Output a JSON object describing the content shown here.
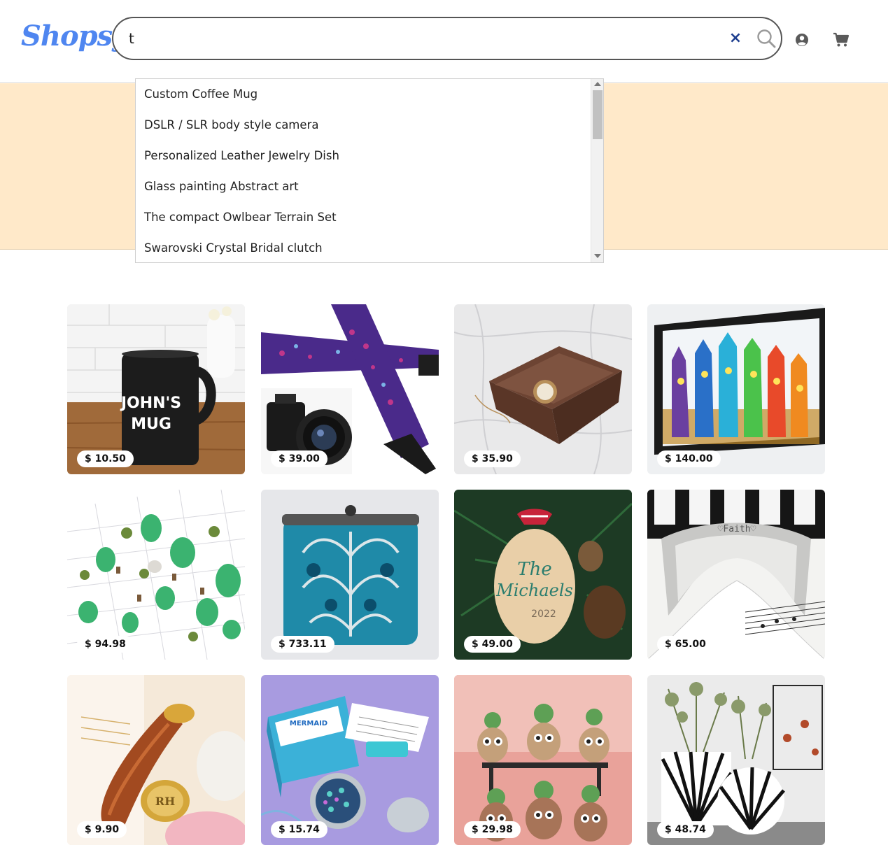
{
  "header": {
    "logo": "Shopsy",
    "search": {
      "value": "t",
      "placeholder": ""
    },
    "clear_symbol": "×",
    "icons": [
      "search-icon",
      "user-icon",
      "cart-icon"
    ]
  },
  "suggestions": [
    "Custom Coffee Mug",
    "DSLR / SLR body style camera",
    "Personalized Leather Jewelry Dish",
    "Glass painting Abstract art",
    "The compact Owlbear Terrain Set",
    "Swarovski Crystal Bridal clutch"
  ],
  "products": [
    {
      "price": "$ 10.50"
    },
    {
      "price": "$ 39.00"
    },
    {
      "price": "$ 35.90"
    },
    {
      "price": "$ 140.00"
    },
    {
      "price": "$ 94.98"
    },
    {
      "price": "$ 733.11"
    },
    {
      "price": "$ 49.00"
    },
    {
      "price": "$ 65.00"
    },
    {
      "price": "$ 9.90"
    },
    {
      "price": "$ 15.74"
    },
    {
      "price": "$ 29.98"
    },
    {
      "price": "$ 48.74"
    }
  ],
  "colors": {
    "brand": "#4f86f0",
    "banner": "#ffe9c9",
    "clear": "#1f3f8f"
  }
}
